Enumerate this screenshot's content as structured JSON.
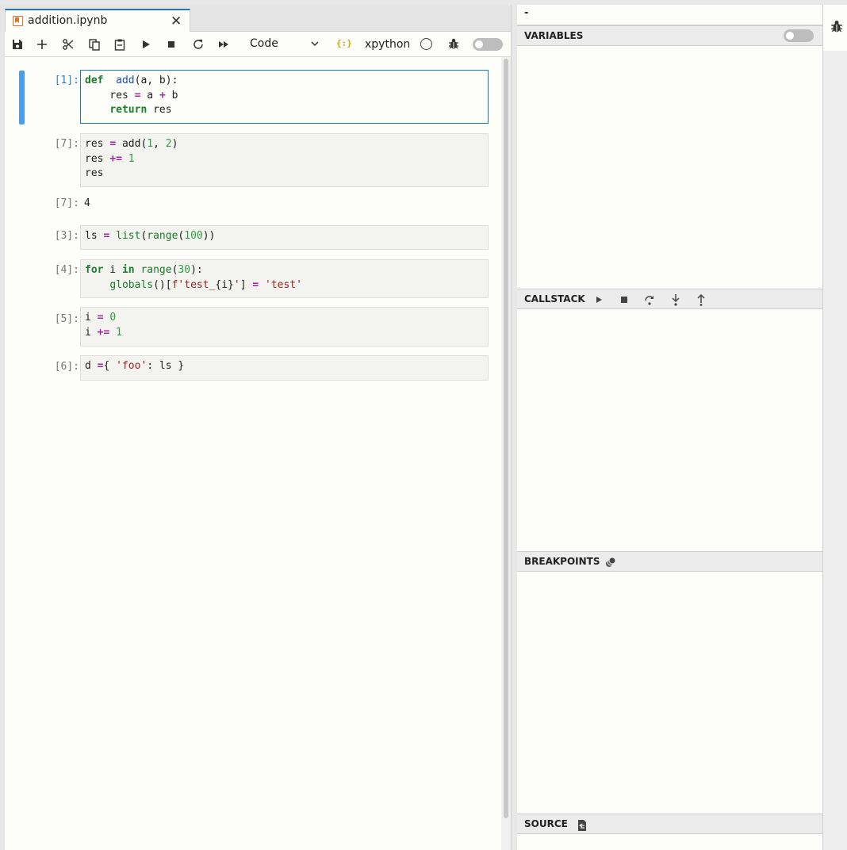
{
  "tab": {
    "title": "addition.ipynb",
    "close_glyph": "✕"
  },
  "toolbar": {
    "cell_type": "Code",
    "kernel_icon_text": "{:}",
    "kernel_name": "xpython"
  },
  "cells": [
    {
      "prompt": "[1]:",
      "lines": [
        [
          [
            "kw",
            "def"
          ],
          [
            "",
            "  "
          ],
          [
            "fn",
            "add"
          ],
          [
            "",
            "(a, b):"
          ]
        ],
        [
          [
            "",
            "    res "
          ],
          [
            "op",
            "="
          ],
          [
            "",
            " a "
          ],
          [
            "op",
            "+"
          ],
          [
            "",
            " b"
          ]
        ],
        [
          [
            "",
            "    "
          ],
          [
            "kw",
            "return"
          ],
          [
            "",
            " res"
          ]
        ]
      ]
    },
    {
      "prompt": "[7]:",
      "lines": [
        [
          [
            "",
            "res "
          ],
          [
            "op",
            "="
          ],
          [
            "",
            " add("
          ],
          [
            "num",
            "1"
          ],
          [
            "",
            ", "
          ],
          [
            "num",
            "2"
          ],
          [
            "",
            ")"
          ]
        ],
        [
          [
            "",
            "res "
          ],
          [
            "op",
            "+="
          ],
          [
            "",
            " "
          ],
          [
            "num",
            "1"
          ]
        ],
        [
          [
            "",
            "res"
          ]
        ]
      ]
    },
    {
      "prompt": "[3]:",
      "lines": [
        [
          [
            "",
            "ls "
          ],
          [
            "op",
            "="
          ],
          [
            "",
            " "
          ],
          [
            "bi",
            "list"
          ],
          [
            "",
            "("
          ],
          [
            "bi",
            "range"
          ],
          [
            "",
            "("
          ],
          [
            "num",
            "100"
          ],
          [
            "",
            "))"
          ]
        ]
      ]
    },
    {
      "prompt": "[4]:",
      "lines": [
        [
          [
            "kw",
            "for"
          ],
          [
            "",
            " i "
          ],
          [
            "kw",
            "in"
          ],
          [
            "",
            " "
          ],
          [
            "bi",
            "range"
          ],
          [
            "",
            "("
          ],
          [
            "num",
            "30"
          ],
          [
            "",
            "):"
          ]
        ],
        [
          [
            "",
            "    "
          ],
          [
            "bi",
            "globals"
          ],
          [
            "",
            "()["
          ],
          [
            "str",
            "f'test_"
          ],
          [
            "",
            "{i}"
          ],
          [
            "str",
            "'"
          ],
          [
            "",
            "] "
          ],
          [
            "op",
            "="
          ],
          [
            "",
            " "
          ],
          [
            "str",
            "'test'"
          ]
        ]
      ]
    },
    {
      "prompt": "[5]:",
      "lines": [
        [
          [
            "",
            "i "
          ],
          [
            "op",
            "="
          ],
          [
            "",
            " "
          ],
          [
            "num",
            "0"
          ]
        ],
        [
          [
            "",
            "i "
          ],
          [
            "op",
            "+="
          ],
          [
            "",
            " "
          ],
          [
            "num",
            "1"
          ]
        ]
      ]
    },
    {
      "prompt": "[6]:",
      "lines": [
        [
          [
            "",
            "d "
          ],
          [
            "op",
            "="
          ],
          [
            "",
            "{ "
          ],
          [
            "str",
            "'foo'"
          ],
          [
            "",
            ": ls }"
          ]
        ]
      ]
    }
  ],
  "output": {
    "prompt": "[7]:",
    "value": "4"
  },
  "debugger": {
    "title": "-",
    "sections": {
      "variables": "VARIABLES",
      "callstack": "CALLSTACK",
      "breakpoints": "BREAKPOINTS",
      "source": "SOURCE"
    }
  }
}
